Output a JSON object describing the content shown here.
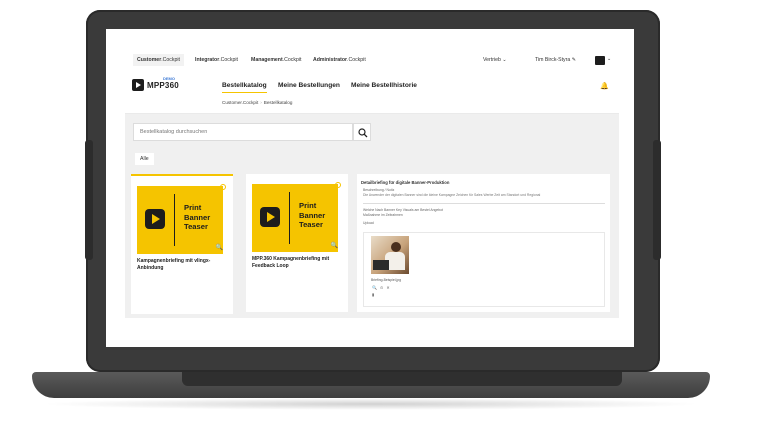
{
  "topbar": {
    "tabs": [
      {
        "strong": "Customer",
        "rest": ".Cockpit"
      },
      {
        "strong": "Integrator",
        "rest": ".Cockpit"
      },
      {
        "strong": "Management",
        "rest": ".Cockpit"
      },
      {
        "strong": "Administrator",
        "rest": ".Cockpit"
      }
    ],
    "role": "Vertrieb",
    "user": "Tim Birck-Styra"
  },
  "navbar": {
    "logo_text": "MPP360",
    "logo_badge": "DEMO",
    "links": [
      "Bestellkatalog",
      "Meine Bestellungen",
      "Meine Bestellhistorie"
    ],
    "breadcrumb": [
      "Customer.Cockpit",
      "Bestellkatalog"
    ]
  },
  "search": {
    "placeholder": "Bestellkatalog durchsuchen"
  },
  "filter": {
    "label": "Alle"
  },
  "cards": [
    {
      "image_text": "Print\nBanner\nTeaser",
      "title": "Kampagnenbriefing mit vlingx-Anbindung"
    },
    {
      "image_text": "Print\nBanner\nTeaser",
      "title": "MPP.360 Kampagnenbriefing mit Feedback Loop"
    }
  ],
  "panel": {
    "title": "Detailbriefing für digitale Banner-Produktion",
    "field1_label": "Beschreibung / Notiz",
    "field1_value": "Die Anwender der digitalen Banner sind die kleine Kampagne Zeichen für Sales Werbe Zeit am Standort und Regional",
    "field2_label": "Welche Nach Banner Key Visuals am Bestel Angebot",
    "field2_value": "Maßnahme im Zeitrahmen",
    "field3_label": "Upload",
    "photo_caption": "Briefing-Beispiel.jpg"
  },
  "colors": {
    "accent": "#f5c400",
    "laptop": "#3a3a3a",
    "app_bg": "#f0f0f0"
  }
}
